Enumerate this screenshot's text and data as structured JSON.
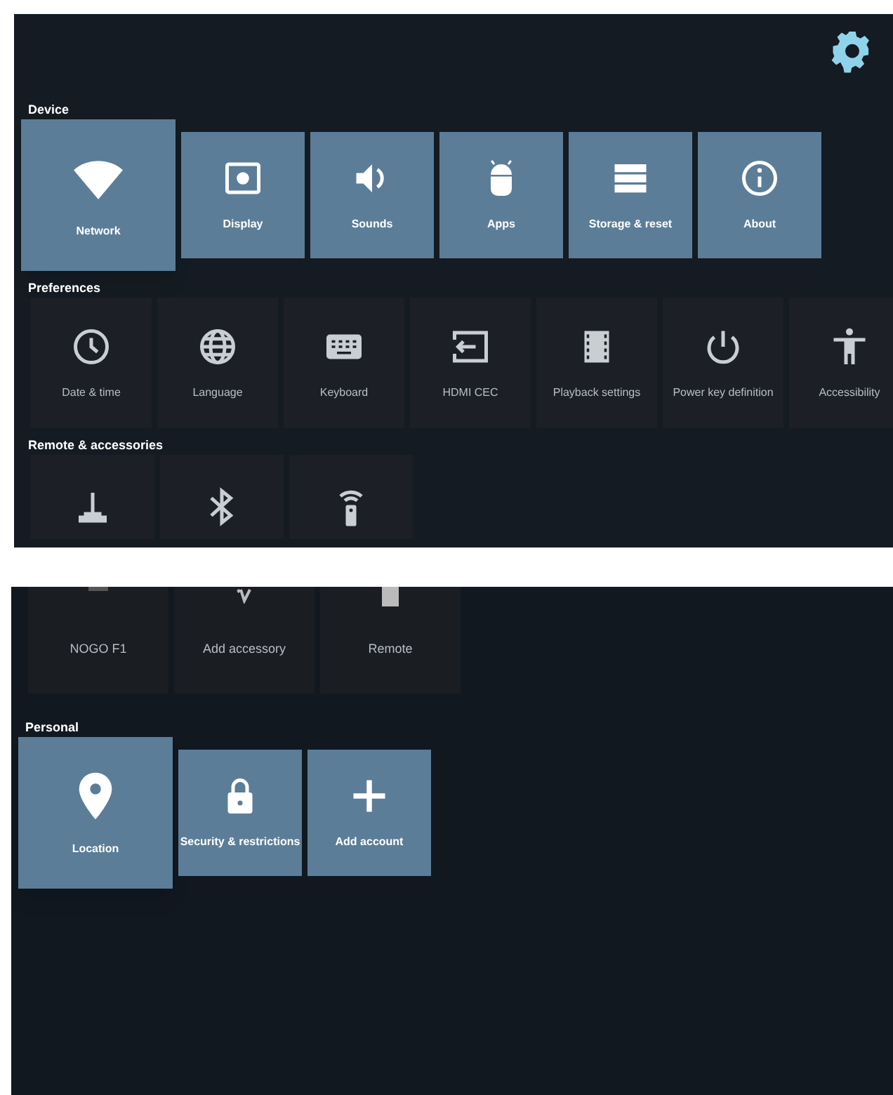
{
  "photos": [
    {
      "sections": [
        {
          "title": "Device",
          "focused": true,
          "items": [
            {
              "label": "Network",
              "selected": true
            },
            {
              "label": "Display",
              "selected": false
            },
            {
              "label": "Sounds",
              "selected": false
            },
            {
              "label": "Apps",
              "selected": false
            },
            {
              "label": "Storage & reset",
              "selected": false
            },
            {
              "label": "About",
              "selected": false
            }
          ]
        },
        {
          "title": "Preferences",
          "focused": false,
          "items": [
            {
              "label": "Date & time",
              "selected": false
            },
            {
              "label": "Language",
              "selected": false
            },
            {
              "label": "Keyboard",
              "selected": false
            },
            {
              "label": "HDMI CEC",
              "selected": false
            },
            {
              "label": "Playback settings",
              "selected": false
            },
            {
              "label": "Power key definition",
              "selected": false
            },
            {
              "label": "Accessibility",
              "selected": false
            }
          ]
        },
        {
          "title": "Remote & accessories",
          "focused": false
        }
      ]
    },
    {
      "continued_labels": [
        "NOGO F1",
        "Add accessory",
        "Remote"
      ],
      "sections": [
        {
          "title": "Personal",
          "focused": true,
          "items": [
            {
              "label": "Location",
              "selected": true
            },
            {
              "label": "Security & restrictions",
              "selected": false
            },
            {
              "label": "Add account",
              "selected": false
            }
          ]
        }
      ]
    }
  ]
}
